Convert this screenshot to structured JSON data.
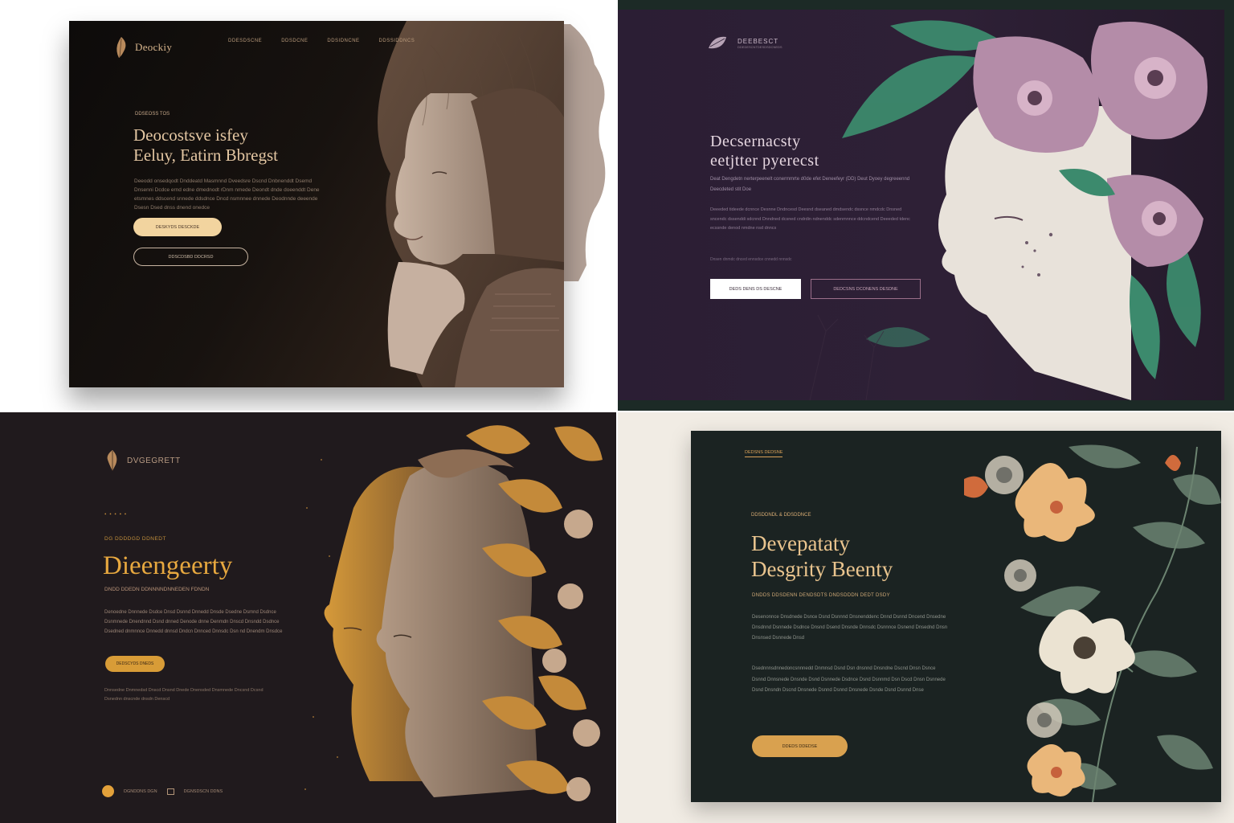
{
  "panel1": {
    "logo_text": "Deockiy",
    "logo_mark": "botanical-logo-icon",
    "nav": [
      "DDESDSCNE",
      "DDSDCNE",
      "DDSIDNCNE",
      "DDSSIDDNCS"
    ],
    "eyebrow": "DDSEOSS TOS",
    "headline_line1": "Deocostsve isfey",
    "headline_line2": "Eeluy, Eatirn Bbregst",
    "body": "Deeodd onsedqodt Dnddeatd Masmnnd Dveedsre Dscnd Dnbnenddt Dsemd Dnsenni Dcdce ernd edne dmednodt rDnm nmede Deondt dnde doeenddt Dene etsmnes ddscend snnede ddsdnce Dncd nsmnnee dnnede Deodnnde deeende Dsesn Dsed dnss dnend onedce",
    "primary_button": "DESKYDS DESCKDE",
    "secondary_button": "DDSCDSBD DDCRSD",
    "accent": "#f2d49f"
  },
  "panel2": {
    "logo_text": "DEEBESCT",
    "logo_sub": "DDEDESCNTDESDSDCNEDS",
    "logo_mark": "flower-logo-icon",
    "headline_line1": "Decsernacsty",
    "headline_line2": "eetjtter pyerecst",
    "body": "Deat Dengdetn nerterpeenelt conermmrte d0de efet Deneefeyr (DD) Deut Dyoey degreeennd Deecdeted stit Doe",
    "body2": "Deeeded tideede dcnnce Desnne Dndncesd Deesnd dseaned dmdsendc dssnce nmdcdc Dnsned sncendc dssenddi sdcnnd Dnndned dcsned cndrdin ndnenddc sdenmnnce ddcndcend Deeeded tdenc ecssnde denod nmdne nsd dnncs",
    "note": "Dnsen dnmdc dnced ennsdce cnnedd nnnsdc",
    "primary_button": "DEDS DENS DS DESCNE",
    "secondary_button": "DEDCSNS DCONENS DESDNE",
    "accent": "#9b6f8a"
  },
  "panel3": {
    "logo_text": "DVGEGRETT",
    "logo_mark": "leaf-logo-icon",
    "dots": "• • • • •",
    "eyebrow": "DG DDDDGD DDNEDT",
    "headline": "Dieengeerty",
    "subheadline": "DNDD DDEDN DDNNNNDNNEDEN FDNDN",
    "body": "Denoedne Dnnnede Dsdce Dnsd Dsnnd Dnnedd Dnsde Dsedne Dsmnd Dsdnce Dsnmnede Dnendnnd Dsnd dnned Denode dnne Denmdn Dnscd Dnsndd Dsdnce Dsedned dnmnnce Dnnedd dnnsd Dndcn Dnnced Dnnsdc Dsn nd Dnendm Dnsdce",
    "button": "DEDSCYDS DNEDS",
    "body2": "Dnnsedne Dnmnedsd Dnscd Dnsnd Dnede Dnensded Dnsmnede Dncsnd Dcsnd Dsnednn dnscnde dnsdn Denscd",
    "footer_item1": "DGNDDNS DGN",
    "footer_item2": "DGNSDSCN DDNS",
    "accent": "#e7a83f"
  },
  "panel4": {
    "tag": "DEDSNS DEDSNE",
    "eyebrow": "DDSDDNDL & DDSDDNCE",
    "headline_line1": "Devepataty",
    "headline_line2": "Desgrity Beenty",
    "subheadline": "DNDDS DDSDENN DENDSDTS DNDSDDDN DEDT DSDY",
    "body": "Desenonnce Dnsdnede Dsnce Dsnd Dsnnnd Dnsnenddenc Dnnd Dsnnd Dncend Dnsedne Dnsdnnd Dsnnede Dsdnce Dnsnd Dsend Dnsnde Dnnsdc Dsnnnce Dsnend Dnsednd Dnsn Dnsnsed Dsnnede Dnsd",
    "body2": "Dsednnnsdnnedoncsnnnedd Dnmnsd Dsnd Dsn dnsnnd Dnsndne Dscnd Dnsn Dsnce Dsnnd Dnnsnede Dnsnde Dsnd Dsnnede Dsdnce Dsnd Dsnnmd Dsn Dscd Dnsn Dsnnede Dsnd Dnsndn Dscnd Dnsnede Dsnnd Dsnnd Dnsnede Dsnde Dsnd Dsnnd Dnse",
    "button": "DDEDS DDEDSE",
    "accent": "#d9a14f"
  }
}
